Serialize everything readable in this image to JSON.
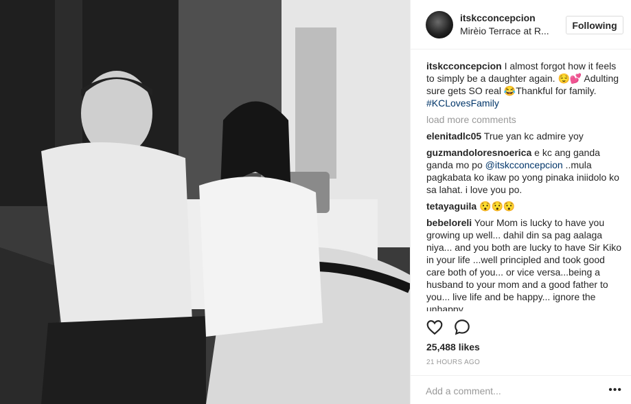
{
  "post": {
    "username": "itskcconcepcion",
    "location": "Mirèio Terrace at R...",
    "follow_label": "Following"
  },
  "caption": {
    "user": "itskcconcepcion",
    "text": " I almost forgot how it feels to simply be a daughter again. 😌💕 Adulting sure gets SO real 😂Thankful for family. ",
    "hashtag": "#KCLovesFamily"
  },
  "load_more": "load more comments",
  "comments": [
    {
      "user": "elenitadlc05",
      "text": " True yan kc admire yoy"
    },
    {
      "user": "guzmandoloresnoerica",
      "text_before": " e kc ang ganda ganda mo po ",
      "mention": "@itskcconcepcion",
      "text_after": " ..mula pagkabata ko ikaw po yong pinaka iniidolo ko sa lahat. i love you po."
    },
    {
      "user": "tetayaguila",
      "text": " 😯😯😯"
    },
    {
      "user": "bebeloreli",
      "text": " Your Mom is lucky to have you growing up well... dahil din sa pag aalaga niya... and you both are lucky to have Sir Kiko in your life ...well principled and took good care both of you... or vice versa...being a husband to your mom and a good father to you... live life and be happy... ignore the unhappy..."
    }
  ],
  "likes": "25,488 likes",
  "timestamp": "21 HOURS AGO",
  "comment_placeholder": "Add a comment...",
  "more_label": "•••",
  "icons": {
    "like": "heart-icon",
    "comment": "comment-bubble-icon",
    "more": "more-dots-icon"
  },
  "colors": {
    "link": "#003569",
    "muted": "#999999",
    "text": "#262626",
    "border": "#dbdbdb"
  }
}
